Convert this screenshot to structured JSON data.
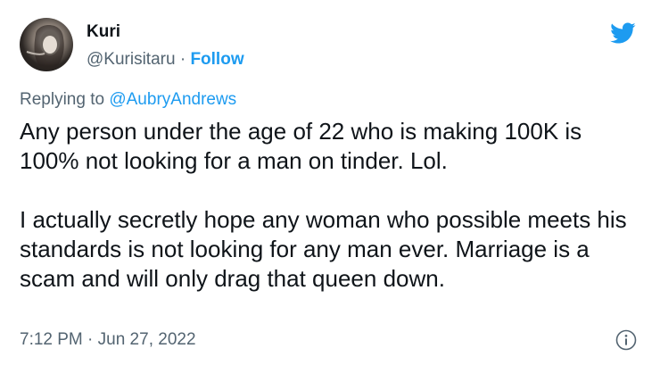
{
  "author": {
    "display_name": "Kuri",
    "handle": "@Kurisitaru",
    "separator": " · ",
    "follow_label": "Follow"
  },
  "reply": {
    "prefix": "Replying to ",
    "mention": "@AubryAndrews"
  },
  "tweet": {
    "paragraph_1": "Any person under the age of 22 who is making 100K is 100% not looking for a man on tinder. Lol.",
    "paragraph_2": "I actually secretly hope any woman who possible meets his standards is not looking for any man ever. Marriage is a scam and will only drag that queen down."
  },
  "meta": {
    "timestamp": "7:12 PM · Jun 27, 2022"
  },
  "icons": {
    "brand": "twitter-bird-icon",
    "info": "info-icon"
  },
  "colors": {
    "accent": "#1d9bf0",
    "secondary_text": "#536471",
    "primary_text": "#0f1419"
  }
}
